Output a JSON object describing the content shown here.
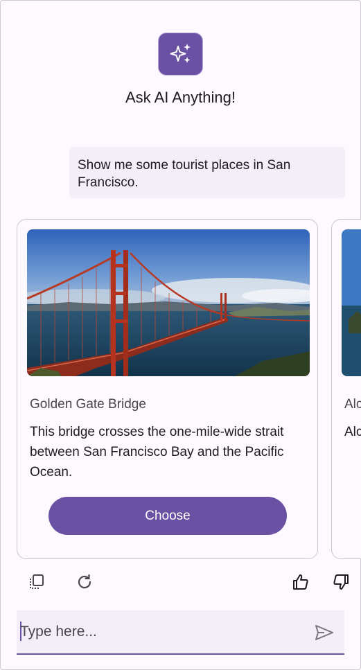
{
  "header": {
    "title": "Ask AI Anything!",
    "logo_icon": "sparkle-icon"
  },
  "chat": {
    "user_message": "Show me some tourist places in San Francisco."
  },
  "cards": [
    {
      "title": "Golden Gate Bridge",
      "description": "This bridge crosses the one-mile-wide strait between San Francisco Bay and the Pacific Ocean.",
      "button_label": "Choose"
    },
    {
      "title": "Alc",
      "description": "Alc isla"
    }
  ],
  "actions": {
    "icons": [
      "copy-icon",
      "refresh-icon",
      "thumbs-up-icon",
      "thumbs-down-icon"
    ]
  },
  "composer": {
    "placeholder": "Type here...",
    "send_icon": "send-icon"
  },
  "colors": {
    "accent": "#6a51a3",
    "surface": "#fdf9fe",
    "bubble": "#f3eef8",
    "border": "#cac4d0"
  }
}
